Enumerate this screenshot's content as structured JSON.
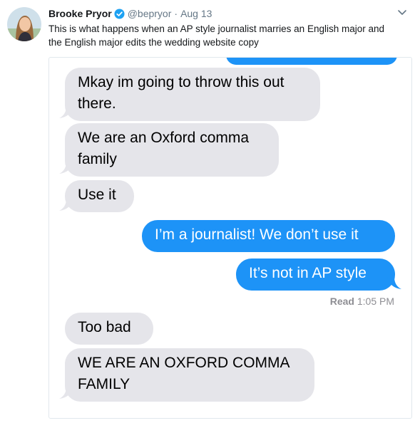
{
  "tweet": {
    "display_name": "Brooke Pryor",
    "handle": "@bepryor",
    "separator": "·",
    "date": "Aug 13",
    "text": "This is what happens when an AP style journalist marries an English major and the English major edits the wedding website copy",
    "verified": true,
    "icons": [
      "avatar",
      "verified-badge-icon",
      "chevron-down-icon"
    ]
  },
  "conversation": {
    "messages": [
      {
        "side": "received",
        "text": "Mkay im going to throw this out there."
      },
      {
        "side": "received",
        "text": "We are an Oxford comma family"
      },
      {
        "side": "received",
        "text": "Use it"
      },
      {
        "side": "sent",
        "text": "I’m a journalist! We don’t use it"
      },
      {
        "side": "sent",
        "text": "It’s not in AP style"
      },
      {
        "side": "received",
        "text": "Too bad"
      },
      {
        "side": "received",
        "text": "WE ARE AN OXFORD COMMA FAMILY"
      }
    ],
    "read_label": "Read",
    "read_time": "1:05 PM"
  },
  "colors": {
    "sent_bubble": "#1d93f7",
    "received_bubble": "#e5e5ea",
    "verified_badge": "#1da1f2",
    "secondary_text": "#657786"
  }
}
